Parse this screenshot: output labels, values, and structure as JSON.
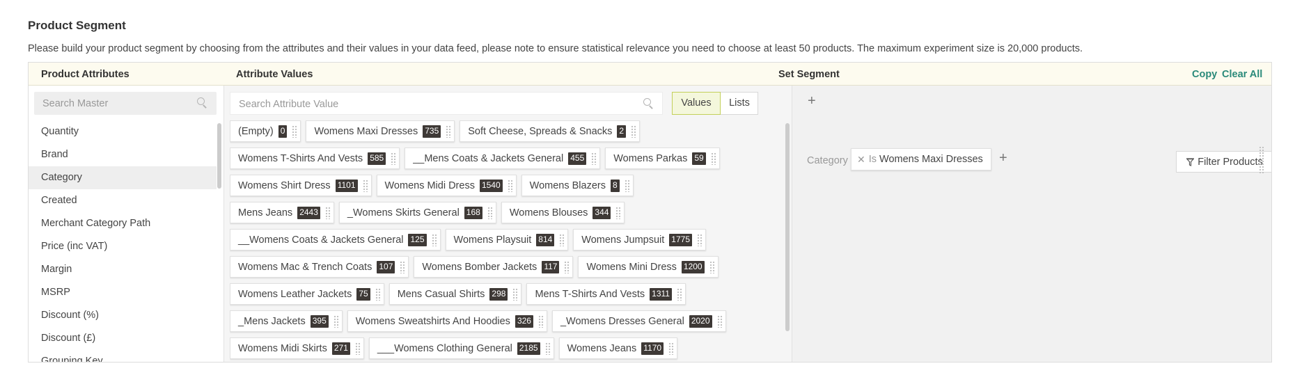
{
  "page": {
    "title": "Product Segment",
    "description": "Please build your product segment by choosing from the attributes and their values in your data feed, please note to ensure statistical relevance you need to choose at least 50 products. The maximum experiment size is 20,000 products."
  },
  "headers": {
    "attributes": "Product Attributes",
    "values": "Attribute Values",
    "segment": "Set Segment",
    "copy": "Copy",
    "clear_all": "Clear All"
  },
  "attributes": {
    "search_placeholder": "Search Master",
    "selected": "Category",
    "items": [
      "Quantity",
      "Brand",
      "Category",
      "Created",
      "Merchant Category Path",
      "Price (inc VAT)",
      "Margin",
      "MSRP",
      "Discount (%)",
      "Discount (£)",
      "Grouping Key"
    ]
  },
  "values": {
    "search_placeholder": "Search Attribute Value",
    "toggle": {
      "values": "Values",
      "lists": "Lists",
      "active": "Values"
    },
    "rows": [
      [
        {
          "label": "(Empty)",
          "count": "0"
        },
        {
          "label": "Womens Maxi Dresses",
          "count": "735"
        },
        {
          "label": "Soft Cheese, Spreads & Snacks",
          "count": "2"
        }
      ],
      [
        {
          "label": "Womens T-Shirts And Vests",
          "count": "585"
        },
        {
          "label": "__Mens Coats & Jackets General",
          "count": "455"
        },
        {
          "label": "Womens Parkas",
          "count": "59"
        }
      ],
      [
        {
          "label": "Womens Shirt Dress",
          "count": "1101"
        },
        {
          "label": "Womens Midi Dress",
          "count": "1540"
        },
        {
          "label": "Womens Blazers",
          "count": "8"
        }
      ],
      [
        {
          "label": "Mens Jeans",
          "count": "2443"
        },
        {
          "label": "_Womens Skirts General",
          "count": "168"
        },
        {
          "label": "Womens Blouses",
          "count": "344"
        }
      ],
      [
        {
          "label": "__Womens Coats & Jackets General",
          "count": "125"
        },
        {
          "label": "Womens Playsuit",
          "count": "814"
        },
        {
          "label": "Womens Jumpsuit",
          "count": "1775"
        }
      ],
      [
        {
          "label": "Womens Mac & Trench Coats",
          "count": "107"
        },
        {
          "label": "Womens Bomber Jackets",
          "count": "117"
        },
        {
          "label": "Womens Mini Dress",
          "count": "1200"
        }
      ],
      [
        {
          "label": "Womens Leather Jackets",
          "count": "75"
        },
        {
          "label": "Mens Casual Shirts",
          "count": "298"
        },
        {
          "label": "Mens T-Shirts And Vests",
          "count": "1311"
        }
      ],
      [
        {
          "label": "_Mens Jackets",
          "count": "395"
        },
        {
          "label": "Womens Sweatshirts And Hoodies",
          "count": "326"
        },
        {
          "label": "_Womens Dresses General",
          "count": "2020"
        }
      ],
      [
        {
          "label": "Womens Midi Skirts",
          "count": "271"
        },
        {
          "label": "___Womens Clothing General",
          "count": "2185"
        },
        {
          "label": "Womens Jeans",
          "count": "1170"
        }
      ]
    ]
  },
  "segment": {
    "add_symbol": "+",
    "rule": {
      "field": "Category",
      "remove_symbol": "✕",
      "operator": "Is",
      "value": "Womens Maxi Dresses"
    },
    "filter_button": "Filter Products",
    "icons": [
      "plus-icon",
      "close-icon",
      "filter-icon",
      "drag-handle-icon",
      "search-icon"
    ]
  }
}
